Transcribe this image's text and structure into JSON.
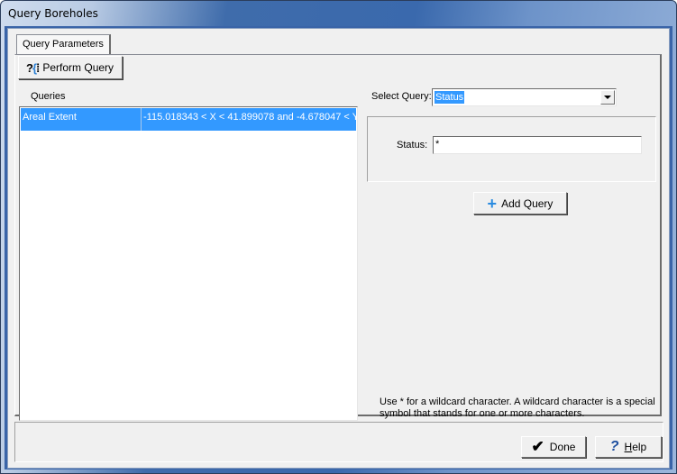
{
  "window": {
    "title": "Query Boreholes"
  },
  "tabs": [
    {
      "label": "Query Parameters",
      "active": true
    }
  ],
  "toolbar": {
    "perform_query_icon": "query-icon",
    "perform_query_label": "Perform Query"
  },
  "queries": {
    "label": "Queries",
    "rows": [
      {
        "name": "Areal Extent",
        "expression": "-115.018343 < X < 41.899078 and -4.678047 < Y",
        "selected": true
      }
    ]
  },
  "select_query": {
    "label": "Select Query:",
    "value": "Status"
  },
  "status_field": {
    "label": "Status:",
    "value": "*"
  },
  "add_query": {
    "icon": "plus-icon",
    "label": "Add Query"
  },
  "hint": "Use * for a wildcard character. A wildcard character is a  special symbol that stands for one or more characters.",
  "footer": {
    "done_icon": "checkmark-icon",
    "done_label": "Done",
    "help_icon": "help-icon",
    "help_mnemonic": "H",
    "help_rest": "elp"
  }
}
